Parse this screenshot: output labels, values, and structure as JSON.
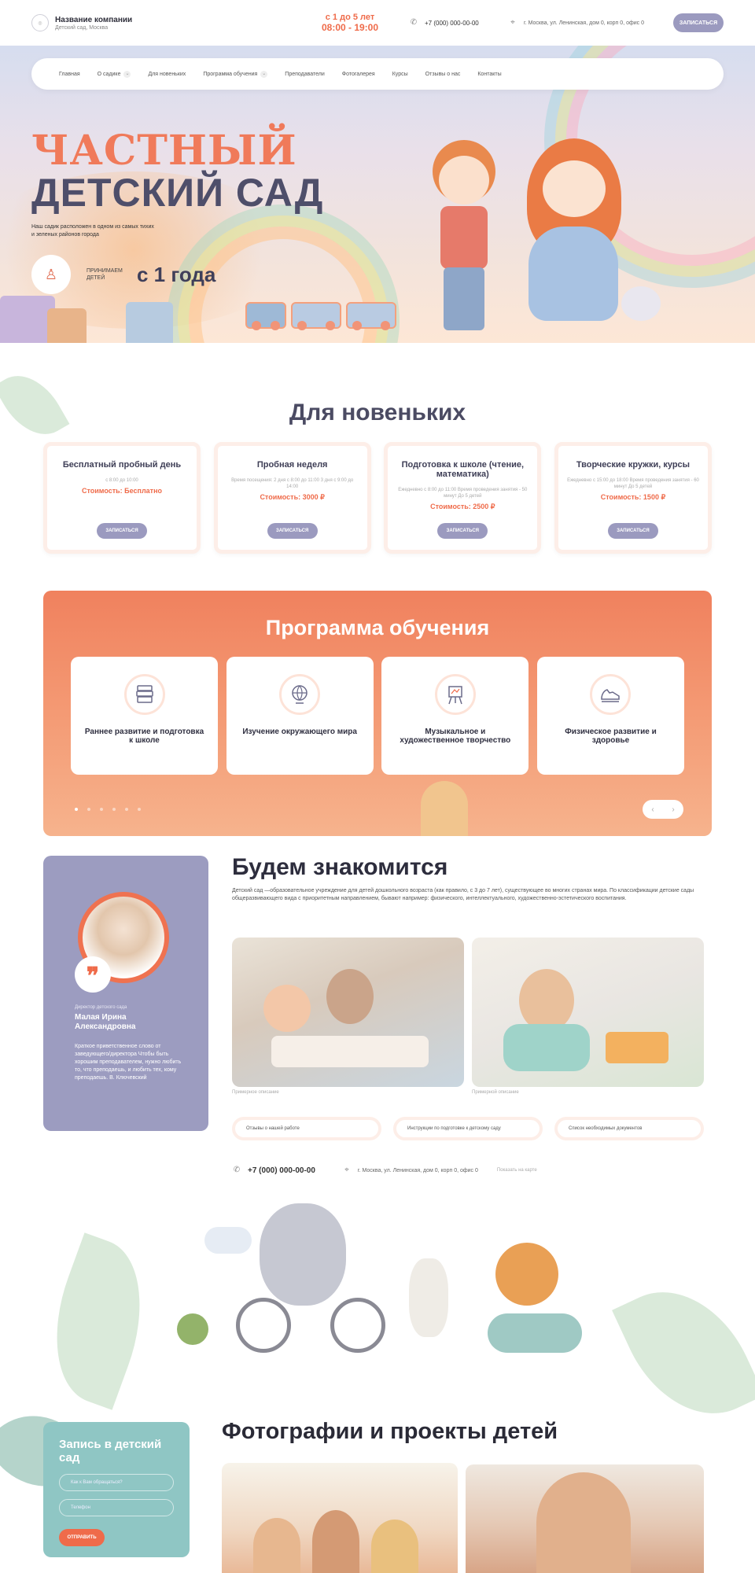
{
  "header": {
    "company_name": "Название компании",
    "company_sub": "Детский сад, Москва",
    "age_range": "с 1 до 5 лет",
    "hours": "08:00 - 19:00",
    "phone": "+7 (000) 000-00-00",
    "address": "г. Москва, ул. Ленинская, дом 0, корп 0, офис 0",
    "signup_label": "ЗАПИСАТЬСЯ"
  },
  "nav": {
    "items": [
      {
        "label": "Главная",
        "has_dropdown": false
      },
      {
        "label": "О садике",
        "has_dropdown": true
      },
      {
        "label": "Для новеньких",
        "has_dropdown": false
      },
      {
        "label": "Программа обучения",
        "has_dropdown": true
      },
      {
        "label": "Преподаватели",
        "has_dropdown": false
      },
      {
        "label": "Фотогалерея",
        "has_dropdown": false
      },
      {
        "label": "Курсы",
        "has_dropdown": false
      },
      {
        "label": "Отзывы о нас",
        "has_dropdown": false
      },
      {
        "label": "Контакты",
        "has_dropdown": false
      }
    ]
  },
  "hero": {
    "title_line1": "ЧАСТНЫЙ",
    "title_line2": "ДЕТСКИЙ САД",
    "description": "Наш садик расположен в одном из самых тихих и зеленых районов города",
    "accept_label": "ПРИНИМАЕМ ДЕТЕЙ",
    "accept_age": "с 1 года"
  },
  "newcomers": {
    "title": "Для новеньких",
    "cards": [
      {
        "title": "Бесплатный пробный день",
        "details": "с 8:00 до 10:00",
        "price": "Стоимость: Бесплатно",
        "button": "ЗАПИСАТЬСЯ"
      },
      {
        "title": "Пробная неделя",
        "details": "Время посещения: 2 дня с 8:00 до 11:00 3 дня с 9:00 до 14:00",
        "price": "Стоимость: 3000 ₽",
        "button": "ЗАПИСАТЬСЯ"
      },
      {
        "title": "Подготовка к школе (чтение, математика)",
        "details": "Ежедневно с 8:00 до 11:00 Время проведения занятия - 50 минут До 5 детей",
        "price": "Стоимость: 2500 ₽",
        "button": "ЗАПИСАТЬСЯ"
      },
      {
        "title": "Творческие кружки, курсы",
        "details": "Ежедневно с 15:00 до 18:00 Время проведения занятия - 60 минут До 5 детей",
        "price": "Стоимость: 1500 ₽",
        "button": "ЗАПИСАТЬСЯ"
      }
    ]
  },
  "program": {
    "title": "Программа обучения",
    "cards": [
      {
        "label": "Раннее развитие и подготовка к школе",
        "icon": "books-icon"
      },
      {
        "label": "Изучение окружающего мира",
        "icon": "globe-icon"
      },
      {
        "label": "Музыкальное и художественное творчество",
        "icon": "easel-icon"
      },
      {
        "label": "Физическое развитие и здоровье",
        "icon": "sneaker-icon"
      }
    ],
    "dots_count": 6,
    "active_dot": 0,
    "prev_label": "‹",
    "next_label": "›"
  },
  "meet": {
    "title": "Будем знакомится",
    "text": "Детский сад —образовательное учреждение для детей дошкольного возраста (как правило, с 3 до 7 лет), существующее во многих странах мира. По классификации детские сады общеразвивающего вида с приоритетным направлением, бывают например: физического, интеллектуального, художественно-эстетического воспитания.",
    "director_role": "Директор детского сада",
    "director_name": "Малая Ирина Александровна",
    "director_quote": "Краткое приветственное слово от заведующего/директора Чтобы быть хорошим преподавателем, нужно любить то, что преподаешь, и любить тех, кому преподаешь. В. Ключевский",
    "photo_captions": [
      "Примерное описание",
      "Примерной описание"
    ],
    "links": [
      "Отзывы о нашей работе",
      "Инструкции по подготовке к детскому саду",
      "Список необходимых документов"
    ],
    "phone": "+7 (000) 000-00-00",
    "address": "г. Москва, ул. Ленинская, дом 0, корп 0, офис 0",
    "map_link": "Показать на карте"
  },
  "signup_form": {
    "title": "Запись в детский сад",
    "name_placeholder": "Как к Вам обращаться?",
    "phone_placeholder": "Телефон",
    "submit": "ОТПРАВИТЬ"
  },
  "photos": {
    "title": "Фотографии и проекты детей"
  },
  "colors": {
    "accent": "#ef6b4a",
    "lavender": "#9c9cc0",
    "teal": "#8fc6c4",
    "dark_text": "#3b3b4f"
  }
}
